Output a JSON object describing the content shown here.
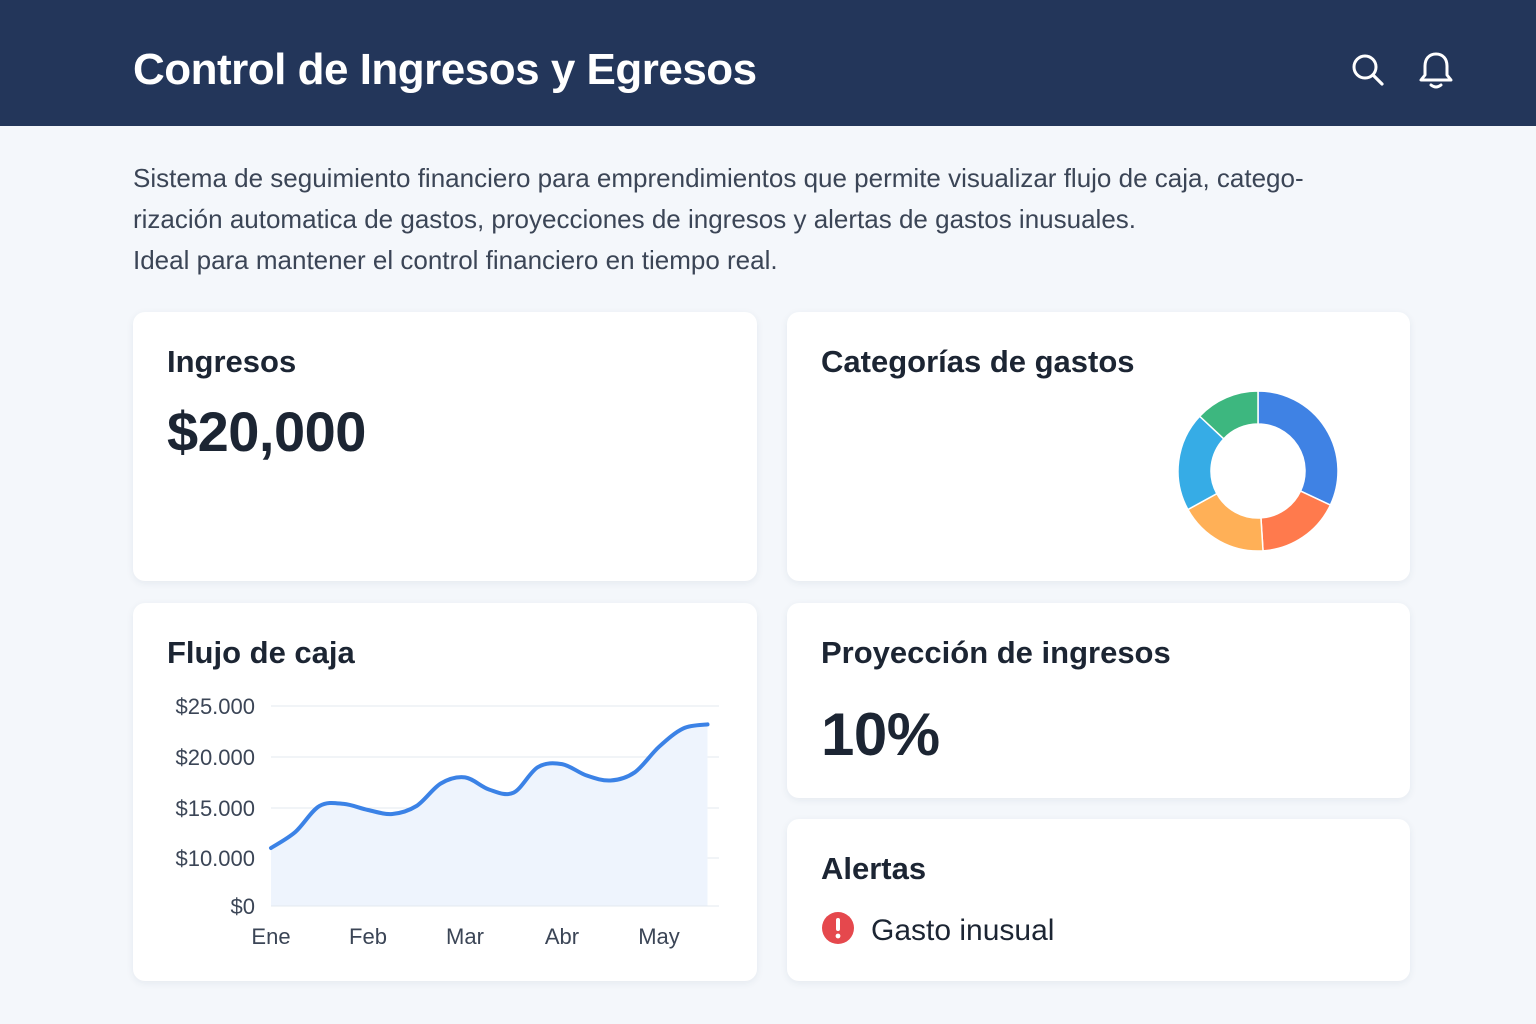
{
  "header": {
    "title": "Control de Ingresos y Egresos",
    "search_icon": "search-icon",
    "notifications_icon": "bell-icon"
  },
  "intro": {
    "line1": "Sistema de seguimiento financiero para emprendimientos que permite visualizar flujo de caja, catego-",
    "line2": "rización automatica de gastos, proyecciones de ingresos y alertas de gastos inusuales.",
    "line3": "Ideal para mantener el control financiero en tiempo real."
  },
  "income": {
    "title": "Ingresos",
    "value": "$20,000"
  },
  "expense_categories": {
    "title": "Categorías de gastos"
  },
  "cash_flow": {
    "title": "Flujo de caja"
  },
  "projection": {
    "title": "Proyección de ingresos",
    "value": "10%"
  },
  "alerts": {
    "title": "Alertas",
    "items": [
      {
        "label": "Gasto inusual",
        "icon": "exclamation-icon",
        "color": "#e5484d"
      }
    ]
  },
  "colors": {
    "header_bg": "#23365a",
    "page_bg": "#f4f7fb",
    "line": "#3b82e6",
    "area": "#eef4fd"
  },
  "chart_data": [
    {
      "type": "line",
      "title": "Flujo de caja",
      "categories": [
        "Ene",
        "Feb",
        "Mar",
        "Abr",
        "May"
      ],
      "x": [
        0,
        0.25,
        0.5,
        0.75,
        1.0,
        1.25,
        1.5,
        1.75,
        2.0,
        2.25,
        2.5,
        2.75,
        3.0,
        3.25,
        3.5,
        3.75,
        4.0,
        4.25,
        4.5
      ],
      "series": [
        {
          "values": [
            11000,
            12600,
            15200,
            15400,
            14800,
            14400,
            15200,
            17400,
            18000,
            16800,
            16500,
            19000,
            19300,
            18200,
            17700,
            18500,
            21000,
            22800,
            23200
          ]
        }
      ],
      "y_ticks": [
        "$25.000",
        "$20.000",
        "$15.000",
        "$10.000",
        "$0"
      ],
      "y_tick_values": [
        25000,
        20000,
        15000,
        10000,
        0
      ],
      "area_fill": true,
      "grid": true
    },
    {
      "type": "pie",
      "title": "Categorías de gastos",
      "donut": true,
      "slices": [
        {
          "value": 32,
          "color": "#3f82e4"
        },
        {
          "value": 17,
          "color": "#ff7a4d"
        },
        {
          "value": 18,
          "color": "#ffb057"
        },
        {
          "value": 20,
          "color": "#36ace6"
        },
        {
          "value": 13,
          "color": "#3db77f"
        }
      ]
    }
  ]
}
